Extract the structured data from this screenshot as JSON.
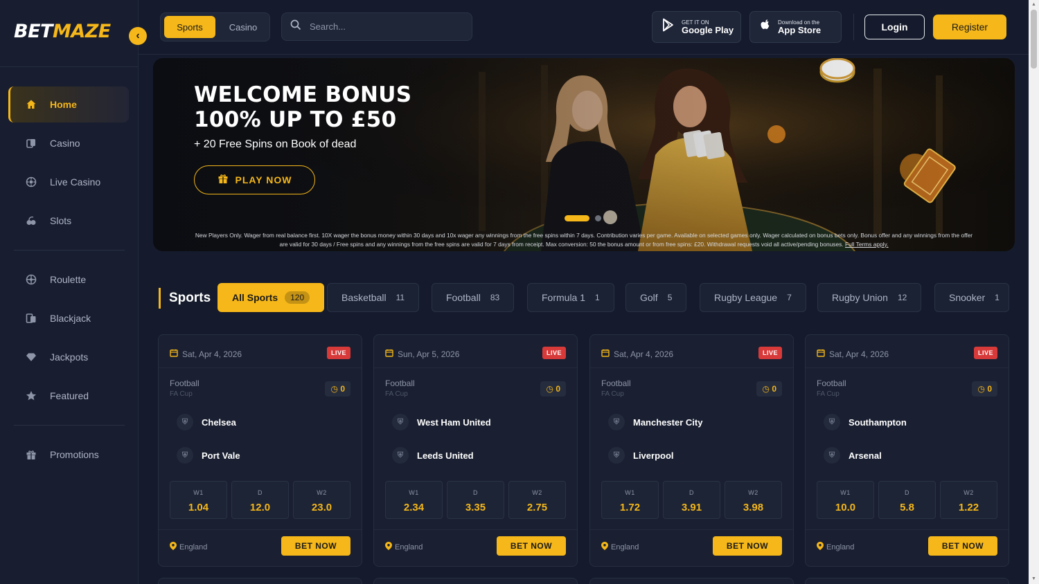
{
  "brand": {
    "name_part1": "BET",
    "name_part2": "MAZE",
    "accent": "#f5b719",
    "bg": "#151b2c"
  },
  "sidebar": {
    "items": [
      {
        "label": "Home",
        "icon": "home-icon",
        "active": true
      },
      {
        "label": "Casino",
        "icon": "casino-icon"
      },
      {
        "label": "Live Casino",
        "icon": "live-casino-icon"
      },
      {
        "label": "Slots",
        "icon": "slots-icon"
      },
      {
        "label": "Roulette",
        "icon": "roulette-icon"
      },
      {
        "label": "Blackjack",
        "icon": "blackjack-icon"
      },
      {
        "label": "Jackpots",
        "icon": "diamond-icon"
      },
      {
        "label": "Featured",
        "icon": "star-icon"
      },
      {
        "label": "Promotions",
        "icon": "gift-icon"
      }
    ]
  },
  "header": {
    "tabs": [
      "Sports",
      "Casino"
    ],
    "search_placeholder": "Search...",
    "google_play": {
      "small": "GET IT ON",
      "large": "Google Play"
    },
    "app_store": {
      "small": "Download on the",
      "large": "App Store"
    },
    "login": "Login",
    "register": "Register"
  },
  "banner": {
    "title_line1": "WELCOME BONUS",
    "title_line2": "100% UP TO £50",
    "subtitle": "+ 20 Free Spins on Book of dead",
    "cta": "PLAY NOW",
    "terms": "New Players Only. Wager from real balance first. 10X wager the bonus money within 30 days and 10x wager any winnings from the free spins within 7 days. Contribution varies per game. Available on selected games only. Wager calculated on bonus bets only. Bonus offer and any winnings from the offer are valid for 30 days / Free spins and any winnings from the free spins are valid for 7 days from receipt. Max conversion: 50 the bonus amount or from free spins: £20. Withdrawal requests void all active/pending bonuses.",
    "terms_link": "Full Terms apply."
  },
  "sports": {
    "title": "Sports",
    "filters": [
      {
        "label": "All Sports",
        "count": "120",
        "selected": true
      },
      {
        "label": "Basketball",
        "count": "11"
      },
      {
        "label": "Football",
        "count": "83"
      },
      {
        "label": "Formula 1",
        "count": "1"
      },
      {
        "label": "Golf",
        "count": "5"
      },
      {
        "label": "Rugby League",
        "count": "7"
      },
      {
        "label": "Rugby Union",
        "count": "12"
      },
      {
        "label": "Snooker",
        "count": "1"
      }
    ]
  },
  "matches": [
    {
      "date": "Sat, Apr 4, 2026",
      "status": "LIVE",
      "sport": "Football",
      "league": "FA Cup",
      "timer": "0",
      "home": "Chelsea",
      "away": "Port Vale",
      "odds": [
        {
          "label": "W1",
          "value": "1.04"
        },
        {
          "label": "D",
          "value": "12.0"
        },
        {
          "label": "W2",
          "value": "23.0"
        }
      ],
      "location": "England",
      "cta": "BET NOW"
    },
    {
      "date": "Sun, Apr 5, 2026",
      "status": "LIVE",
      "sport": "Football",
      "league": "FA Cup",
      "timer": "0",
      "home": "West Ham United",
      "away": "Leeds United",
      "odds": [
        {
          "label": "W1",
          "value": "2.34"
        },
        {
          "label": "D",
          "value": "3.35"
        },
        {
          "label": "W2",
          "value": "2.75"
        }
      ],
      "location": "England",
      "cta": "BET NOW"
    },
    {
      "date": "Sat, Apr 4, 2026",
      "status": "LIVE",
      "sport": "Football",
      "league": "FA Cup",
      "timer": "0",
      "home": "Manchester City",
      "away": "Liverpool",
      "odds": [
        {
          "label": "W1",
          "value": "1.72"
        },
        {
          "label": "D",
          "value": "3.91"
        },
        {
          "label": "W2",
          "value": "3.98"
        }
      ],
      "location": "England",
      "cta": "BET NOW"
    },
    {
      "date": "Sat, Apr 4, 2026",
      "status": "LIVE",
      "sport": "Football",
      "league": "FA Cup",
      "timer": "0",
      "home": "Southampton",
      "away": "Arsenal",
      "odds": [
        {
          "label": "W1",
          "value": "10.0"
        },
        {
          "label": "D",
          "value": "5.8"
        },
        {
          "label": "W2",
          "value": "1.22"
        }
      ],
      "location": "England",
      "cta": "BET NOW"
    }
  ]
}
